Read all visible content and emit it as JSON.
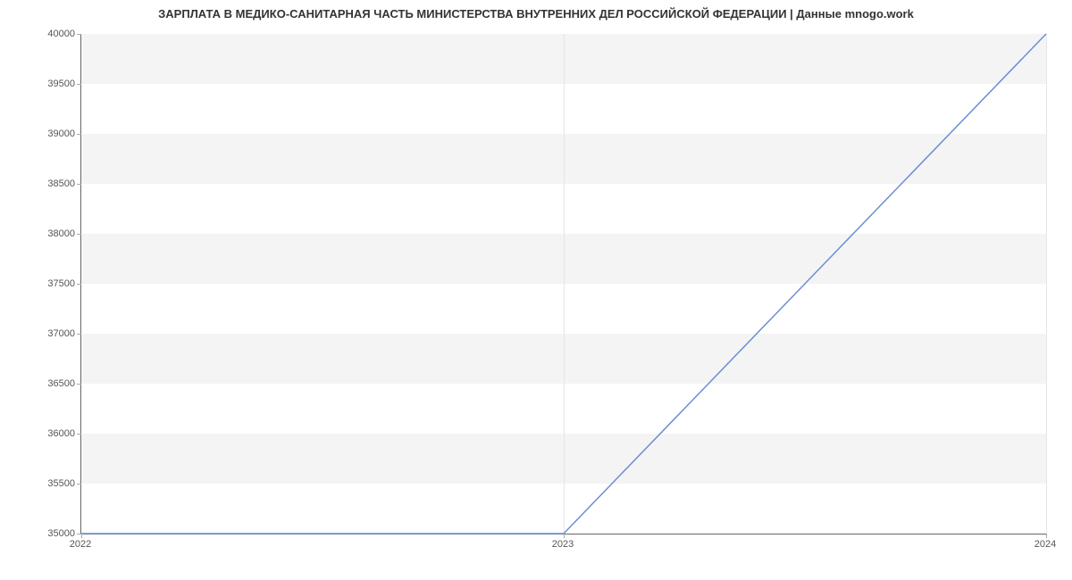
{
  "chart_data": {
    "type": "line",
    "title": "ЗАРПЛАТА В  МЕДИКО-САНИТАРНАЯ ЧАСТЬ МИНИСТЕРСТВА ВНУТРЕННИХ ДЕЛ РОССИЙСКОЙ ФЕДЕРАЦИИ | Данные mnogo.work",
    "x": [
      2022,
      2023,
      2024
    ],
    "values": [
      35000,
      35000,
      40000
    ],
    "y_ticks": [
      35000,
      35500,
      36000,
      36500,
      37000,
      37500,
      38000,
      38500,
      39000,
      39500,
      40000
    ],
    "x_ticks": [
      2022,
      2023,
      2024
    ],
    "ylim": [
      35000,
      40000
    ],
    "xlim": [
      2022,
      2024
    ],
    "line_color": "#6a8fd4"
  }
}
